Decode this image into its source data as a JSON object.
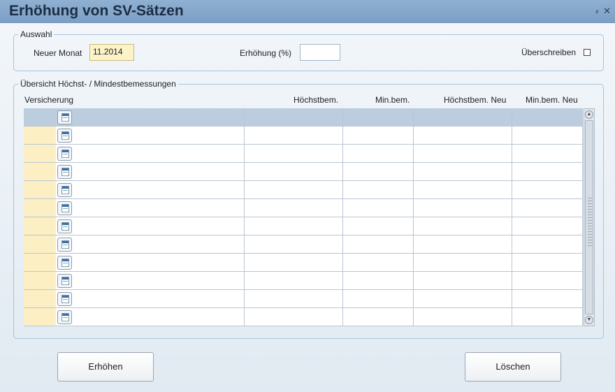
{
  "window": {
    "title": "Erhöhung von SV-Sätzen",
    "pin_glyph": "⸗",
    "close_glyph": "✕"
  },
  "auswahl": {
    "legend": "Auswahl",
    "neuer_monat_label": "Neuer Monat",
    "neuer_monat_value": "11.2014",
    "erhoehung_label": "Erhöhung (%)",
    "erhoehung_value": "",
    "ueberschreiben_label": "Überschreiben",
    "ueberschreiben_checked": false
  },
  "uebersicht": {
    "legend": "Übersicht Höchst- / Mindestbemessungen",
    "columns": {
      "versicherung": "Versicherung",
      "hoechstbem": "Höchstbem.",
      "minbem": "Min.bem.",
      "hoechstbem_neu": "Höchstbem. Neu",
      "minbem_neu": "Min.bem. Neu"
    },
    "row_count": 12,
    "selected_row": 0
  },
  "buttons": {
    "erhoehen": "Erhöhen",
    "loeschen": "Löschen"
  },
  "icons": {
    "lookup": "lookup-list-icon",
    "scroll_up": "chevron-up-icon",
    "scroll_down": "chevron-down-icon"
  },
  "colors": {
    "titlebar": "#7b9fc4",
    "selected_row": "#bccddf",
    "marker_column": "#fbefc3"
  }
}
